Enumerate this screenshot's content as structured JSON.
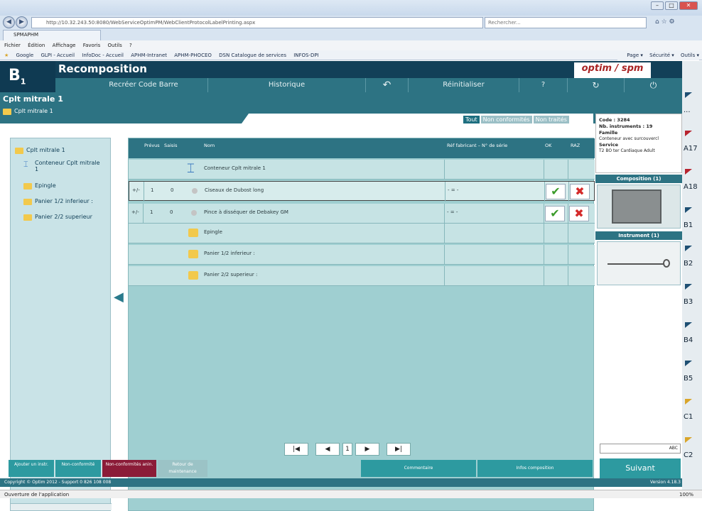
{
  "browser": {
    "url": "http://10.32.243.50:8080/WebServiceOptimPM/WebClientProtocolLabelPrinting.aspx",
    "search_placeholder": "Rechercher...",
    "tab_title": "SPMAPHM",
    "menu": [
      "Fichier",
      "Édition",
      "Affichage",
      "Favoris",
      "Outils",
      "?"
    ],
    "favorites": [
      "Google",
      "GLPI - Accueil",
      "InfoDoc - Accueil",
      "APHM-Intranet",
      "APHM-PHOCEO",
      "DSN Catalogue de services",
      "INFOS-DPI"
    ],
    "commands": [
      "Page ▾",
      "Sécurité ▾",
      "Outils ▾"
    ]
  },
  "app": {
    "logo": "B",
    "logo_sub": "1",
    "title": "Recomposition",
    "brand": "optim / spm",
    "toolbar": [
      "Recréer Code Barre",
      "Historique",
      "↶",
      "Réinitialiser",
      "?",
      "↻",
      "⏻"
    ],
    "crumb_title": "Cplt mitrale 1",
    "crumb_sub": "Cplt mitrale 1",
    "filters": [
      "Tout",
      "Non conformités",
      "Non traités"
    ]
  },
  "tree": [
    {
      "label": "Cplt mitrale 1",
      "level": 0
    },
    {
      "label": "Conteneur Cplt mitrale 1",
      "level": 1
    },
    {
      "label": "Epingle",
      "level": 1
    },
    {
      "label": "Panier 1/2 inferieur :",
      "level": 1
    },
    {
      "label": "Panier 2/2 superieur",
      "level": 1
    }
  ],
  "grid": {
    "headers": [
      "Prévus",
      "Saisis",
      "Nom",
      "Réf fabricant – N° de série",
      "OK",
      "RAZ"
    ],
    "rows": [
      {
        "kind": "container",
        "name": "Conteneur Cplt mitrale 1"
      },
      {
        "kind": "item",
        "adj": "+/-",
        "prevus": "1",
        "saisis": "0",
        "name": "Ciseaux de Dubost long",
        "ref": "- = -"
      },
      {
        "kind": "item",
        "adj": "+/-",
        "prevus": "1",
        "saisis": "0",
        "name": "Pince à disséquer de Debakey GM",
        "ref": "- = -"
      },
      {
        "kind": "folder",
        "name": "Epingle"
      },
      {
        "kind": "folder",
        "name": "Panier 1/2 inferieur :"
      },
      {
        "kind": "folder",
        "name": "Panier 2/2 superieur :"
      }
    ]
  },
  "pager": {
    "first": "|◀",
    "prev": "◀",
    "page": "1",
    "next": "▶",
    "last": "▶|"
  },
  "info": {
    "code": "Code : 3284",
    "nb": "Nb. instruments : 19",
    "famille_label": "Famille",
    "famille": "Conteneur avec surcouvercl",
    "service_label": "Service",
    "service": "T2 BO ter Cardiaque Adult"
  },
  "composition_title": "Composition (1)",
  "instrument_title": "Instrument (1)",
  "search_hint": "ABC",
  "suivant": "Suivant",
  "bottom": [
    "Ajouter un instr.",
    "Non-conformité",
    "Non-conformités anin.",
    "Retour de maintenance",
    "Commentaire",
    "Infos composition"
  ],
  "copyright": "Copyright © Optim 2012 - Support 0 826 108 008",
  "version": "Version 4.18.3",
  "status": "Ouverture de l'application",
  "zoom": "100%",
  "right_tabs": [
    "...",
    "A17",
    "A18",
    "B1",
    "B2",
    "B3",
    "B4",
    "B5",
    "C1",
    "C2"
  ],
  "colors": {
    "primary": "#2d7383",
    "dark": "#124058",
    "grid": "#9fcfd1",
    "ok": "#3b9b2a",
    "raz": "#d42a2a"
  }
}
